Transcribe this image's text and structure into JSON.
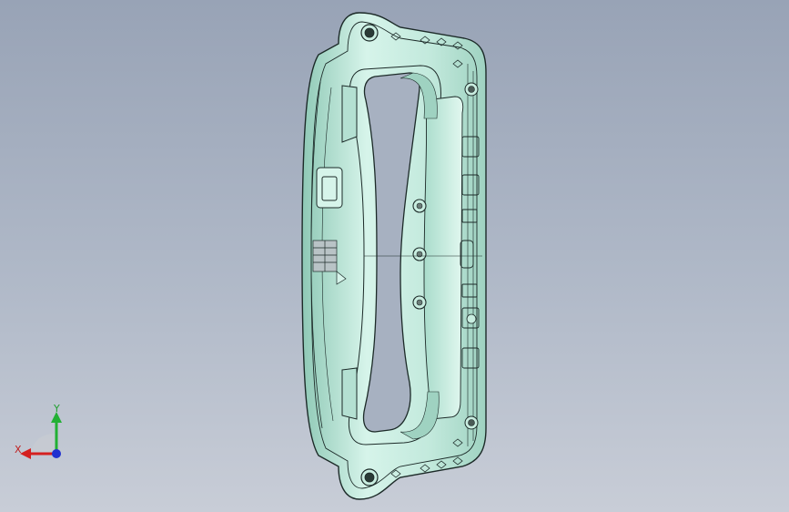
{
  "viewport": {
    "background_top": "#98a3b6",
    "background_bottom": "#c8cdd7"
  },
  "model": {
    "icon": "cad-part-handle",
    "fill": "#c9ede0",
    "fill_shadow": "#8fc9b6",
    "edge": "#1c2a28"
  },
  "triad": {
    "x_label": "X",
    "y_label": "Y",
    "x_color": "#d42020",
    "y_color": "#22b034",
    "z_color": "#2030d0"
  }
}
